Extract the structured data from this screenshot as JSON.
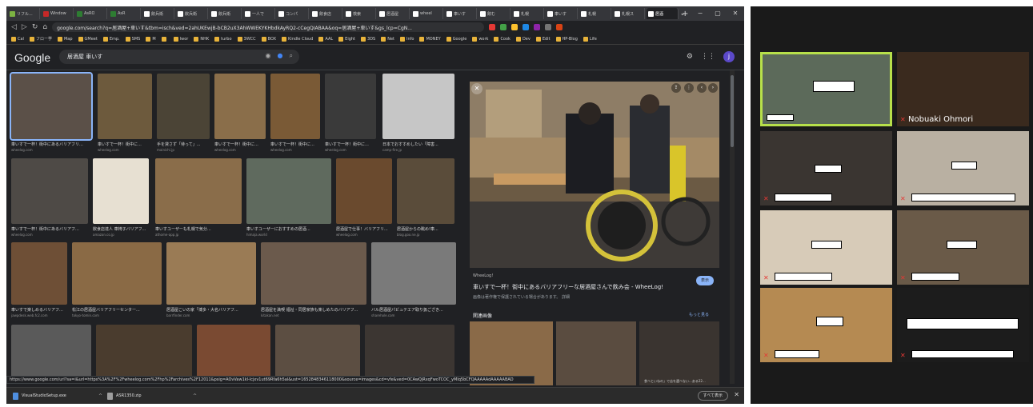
{
  "browser": {
    "tabs": [
      "リフル...",
      "Window",
      "AsRO",
      "AsR",
      "飲兵衛",
      "飲兵衛",
      "飲兵衛",
      "一人で",
      "コンパ",
      "飲食店",
      "検索",
      "居酒屋",
      "wheel",
      "車いす",
      "飲む",
      "札幌",
      "車いす",
      "札幌",
      "札幌ス",
      "居酒"
    ],
    "window_controls": [
      "⌄",
      "−",
      "▢",
      "✕"
    ],
    "new_tab": "+",
    "url": "google.com/search?q=居酒屋+車いす&tbm=isch&ved=2ahUKEwjB-bCB2uX3AhWWEKYKHbdkAyRQ2-cCegQIABAA&oq=居酒屋+車いす&gs_lcp=CgN...",
    "bookmarks": [
      "Cal",
      "フロー学",
      "Map",
      "GMeet",
      "Emp.",
      "SMS",
      "M",
      "",
      "Iwor",
      "NHK",
      "turbo",
      "3WCC",
      "BOX",
      "Kindle Cloud",
      "AAL",
      "Eight",
      "3DS",
      "Net",
      "Info",
      "MONEY",
      "Google",
      "work",
      "Cook",
      "Dev",
      "Edit",
      "HP-Blog",
      "Life"
    ]
  },
  "google": {
    "logo": "Google",
    "query": "居酒屋 車いす",
    "avatar": "j"
  },
  "results": [
    {
      "cap": "車いすで一杯！街中にあるバリアフリ...",
      "src": "wheelog.com"
    },
    {
      "cap": "車いすで一杯！街中に...",
      "src": "wheelog.com"
    },
    {
      "cap": "手を貸さず「待って」...",
      "src": "mainichi.jp"
    },
    {
      "cap": "車いすで一杯！街中に...",
      "src": "wheelog.com"
    },
    {
      "cap": "車いすで一杯！街中に...",
      "src": "wheelog.com"
    },
    {
      "cap": "車いすで一杯！街中に...",
      "src": "wheelog.com"
    },
    {
      "cap": "日本でおすすめしたい「障害...",
      "src": "camp-fire.jp"
    },
    {
      "cap": "車いすで一杯！街中にあるバリアフ...",
      "src": "wheelog.com"
    },
    {
      "cap": "飲食店達人 車椅子バリアフ...",
      "src": "amazon.co.jp"
    },
    {
      "cap": "車いすユーザーも札幌で気分...",
      "src": "athome-app.jp"
    },
    {
      "cap": "車いすユーザーにおすすめの居酒...",
      "src": "himaja.world"
    },
    {
      "cap": "居酒屋で仕事！バリアフリ...",
      "src": "wheelog.com"
    },
    {
      "cap": "居酒屋からの眺め!車...",
      "src": "blog.goo.ne.jp"
    },
    {
      "cap": "車いすで楽しめるバリアフ...",
      "src": "jawpdesk.web.fc2.com"
    },
    {
      "cap": "松江の居酒屋バリアフリーセンター...",
      "src": "tokyo-tomin.com"
    },
    {
      "cap": "居酒屋こいの家「博多・大名バリアフ...",
      "src": "barrfinder.com"
    },
    {
      "cap": "居酒屋を満喫 福祉・同居家族も楽しめたのバリアフ...",
      "src": "kitakan.net"
    },
    {
      "cap": "バル居酒屋パビュテエア取り扱ござき...",
      "src": "sharehole.com"
    },
    {
      "cap": "",
      "src": ""
    },
    {
      "cap": "",
      "src": ""
    },
    {
      "cap": "",
      "src": ""
    },
    {
      "cap": "",
      "src": ""
    },
    {
      "cap": "",
      "src": ""
    }
  ],
  "preview": {
    "source": "WheeLog!",
    "title": "車いすで一杯！街中にあるバリアフリーな居酒屋さんで飲み会 - WheeLog!",
    "note": "画像は著作権で保護されている場合があります。 詳細",
    "visit": "表示",
    "related": "関連画像",
    "more": "もっと見る",
    "related_caption": "食べといねの」で店を選べない...ある22..."
  },
  "status_url": "https://www.google.com/url?sa=i&url=https%3A%2F%2Fwheelog.com%2Fhp%2Farchives%2F12011&psig=AOvVaw1kl-lcjxv1ut69Rfa6h5al&ust=1652848346118000&source=images&cd=vfe&ved=0CAwQjRxqFwoTCOC_yMlq5bCFQAAAAAdAAAAABAD",
  "downloads": [
    {
      "name": "VisualStudioSetup.exe",
      "chev": "^"
    },
    {
      "name": "ASR1350.zip",
      "chev": "^"
    }
  ],
  "show_all": "すべて表示",
  "zoom": {
    "participants": [
      {
        "name": "",
        "muted": false,
        "active": true
      },
      {
        "name": "Nobuaki Ohmori",
        "muted": true,
        "active": false
      },
      {
        "name": "",
        "muted": true,
        "active": false
      },
      {
        "name": "",
        "muted": true,
        "active": false
      },
      {
        "name": "",
        "muted": true,
        "active": false
      },
      {
        "name": "",
        "muted": true,
        "active": false
      },
      {
        "name": "",
        "muted": true,
        "active": false
      },
      {
        "name": "",
        "muted": true,
        "active": false
      }
    ]
  }
}
